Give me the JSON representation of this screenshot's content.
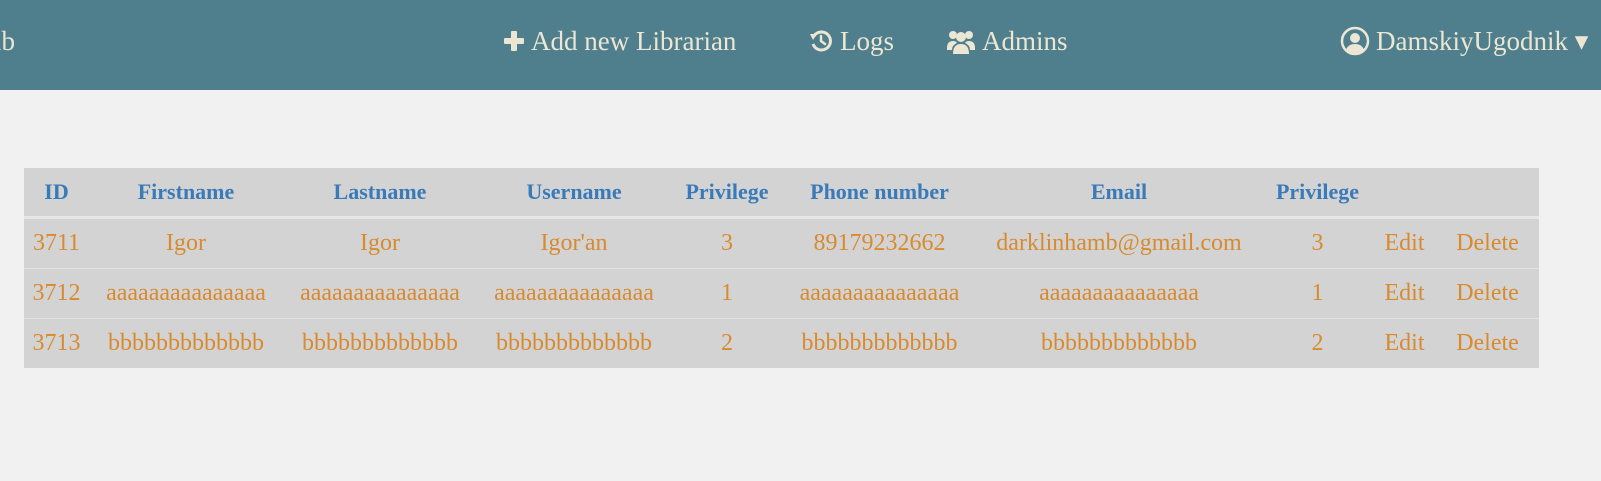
{
  "nav": {
    "brand": "ib",
    "add_librarian": "Add new Librarian",
    "logs": "Logs",
    "admins": "Admins",
    "user": "DamskiyUgodnik ▾"
  },
  "table": {
    "headers": [
      "ID",
      "Firstname",
      "Lastname",
      "Username",
      "Privilege",
      "Phone number",
      "Email",
      "Privilege",
      "",
      ""
    ],
    "rows": [
      {
        "id": "3711",
        "firstname": "Igor",
        "lastname": "Igor",
        "username": "Igor'an",
        "privilege": "3",
        "phone": "89179232662",
        "email": "darklinhamb@gmail.com",
        "privilege2": "3",
        "edit": "Edit",
        "delete": "Delete"
      },
      {
        "id": "3712",
        "firstname": "aaaaaaaaaaaaaaa",
        "lastname": "aaaaaaaaaaaaaaa",
        "username": "aaaaaaaaaaaaaaa",
        "privilege": "1",
        "phone": "aaaaaaaaaaaaaaa",
        "email": "aaaaaaaaaaaaaaa",
        "privilege2": "1",
        "edit": "Edit",
        "delete": "Delete"
      },
      {
        "id": "3713",
        "firstname": "bbbbbbbbbbbbb",
        "lastname": "bbbbbbbbbbbbb",
        "username": "bbbbbbbbbbbbb",
        "privilege": "2",
        "phone": "bbbbbbbbbbbbb",
        "email": "bbbbbbbbbbbbb",
        "privilege2": "2",
        "edit": "Edit",
        "delete": "Delete"
      }
    ]
  },
  "colors": {
    "navbar": "#4f7f8c",
    "nav_text": "#ece6d4",
    "header_text": "#3a7ab8",
    "cell_text": "#d88a2f",
    "table_bg": "#d3d3d3",
    "page_bg": "#f1f1f1"
  },
  "icons": {
    "add": "plus-icon",
    "logs": "history-icon",
    "admins": "users-icon",
    "user": "user-circle-icon"
  }
}
